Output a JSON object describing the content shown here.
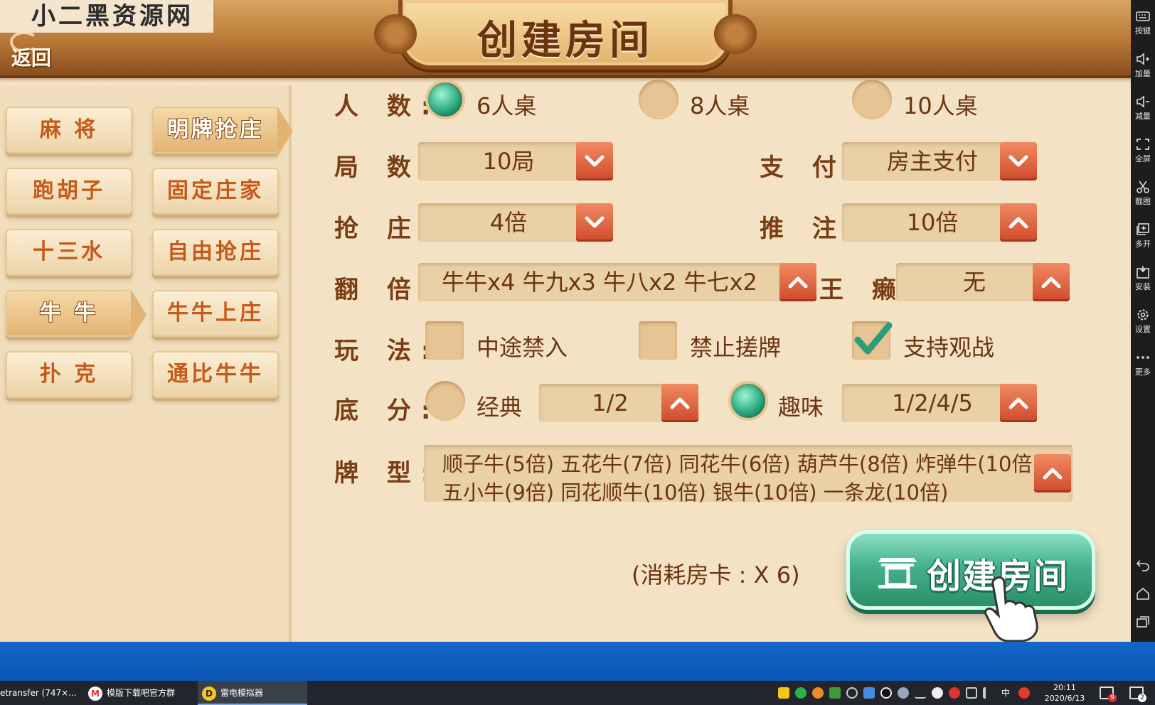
{
  "watermark": "小二黑资源网",
  "header": {
    "back_label": "返回",
    "title": "创建房间"
  },
  "sidebar": {
    "categories": [
      "麻 将",
      "跑胡子",
      "十三水",
      "牛 牛",
      "扑 克"
    ],
    "modes": [
      "明牌抢庄",
      "固定庄家",
      "自由抢庄",
      "牛牛上庄",
      "通比牛牛"
    ]
  },
  "form": {
    "players": {
      "label": "人 数:",
      "options": [
        "6人桌",
        "8人桌",
        "10人桌"
      ],
      "selected": "6人桌"
    },
    "rounds": {
      "label": "局 数:",
      "value": "10局"
    },
    "payment": {
      "label": "支 付:",
      "value": "房主支付"
    },
    "rob": {
      "label": "抢 庄:",
      "value": "4倍"
    },
    "push": {
      "label": "推 注:",
      "value": "10倍"
    },
    "multiply": {
      "label": "翻 倍:",
      "value": "牛牛x4 牛九x3 牛八x2 牛七x2"
    },
    "wildcard": {
      "label": "王 癞:",
      "value": "无"
    },
    "rules": {
      "label": "玩 法:",
      "options": [
        "中途禁入",
        "禁止搓牌",
        "支持观战"
      ],
      "checked": [
        "支持观战"
      ]
    },
    "base_score": {
      "label": "底 分:",
      "options": [
        "经典",
        "趣味"
      ],
      "selected": "趣味",
      "classic_value": "1/2",
      "fun_value": "1/2/4/5"
    },
    "card_types": {
      "label": "牌 型:",
      "line1": "顺子牛(5倍) 五花牛(7倍) 同花牛(6倍) 葫芦牛(8倍) 炸弹牛(10倍)",
      "line2": "五小牛(9倍) 同花顺牛(10倍) 银牛(10倍) 一条龙(10倍)"
    }
  },
  "footer": {
    "cost_text": "(消耗房卡 : X 6)",
    "create_label": "创建房间"
  },
  "emulator_bar": [
    "按键",
    "加量",
    "减量",
    "全屏",
    "截图",
    "多开",
    "安装",
    "设置",
    "更多"
  ],
  "taskbar": {
    "tasks": [
      "etransfer (747×...",
      "模版下载吧官方群",
      "雷电模拟器"
    ],
    "clock_time": "20:11",
    "clock_date": "2020/6/13",
    "ime": "中",
    "notification_count": "9",
    "message_count": "2"
  },
  "colors": {
    "accent_green": "#3cb990",
    "arrow_red": "#d04a2c",
    "label_brown": "#7a3e14",
    "category_orange": "#c55a1a"
  }
}
